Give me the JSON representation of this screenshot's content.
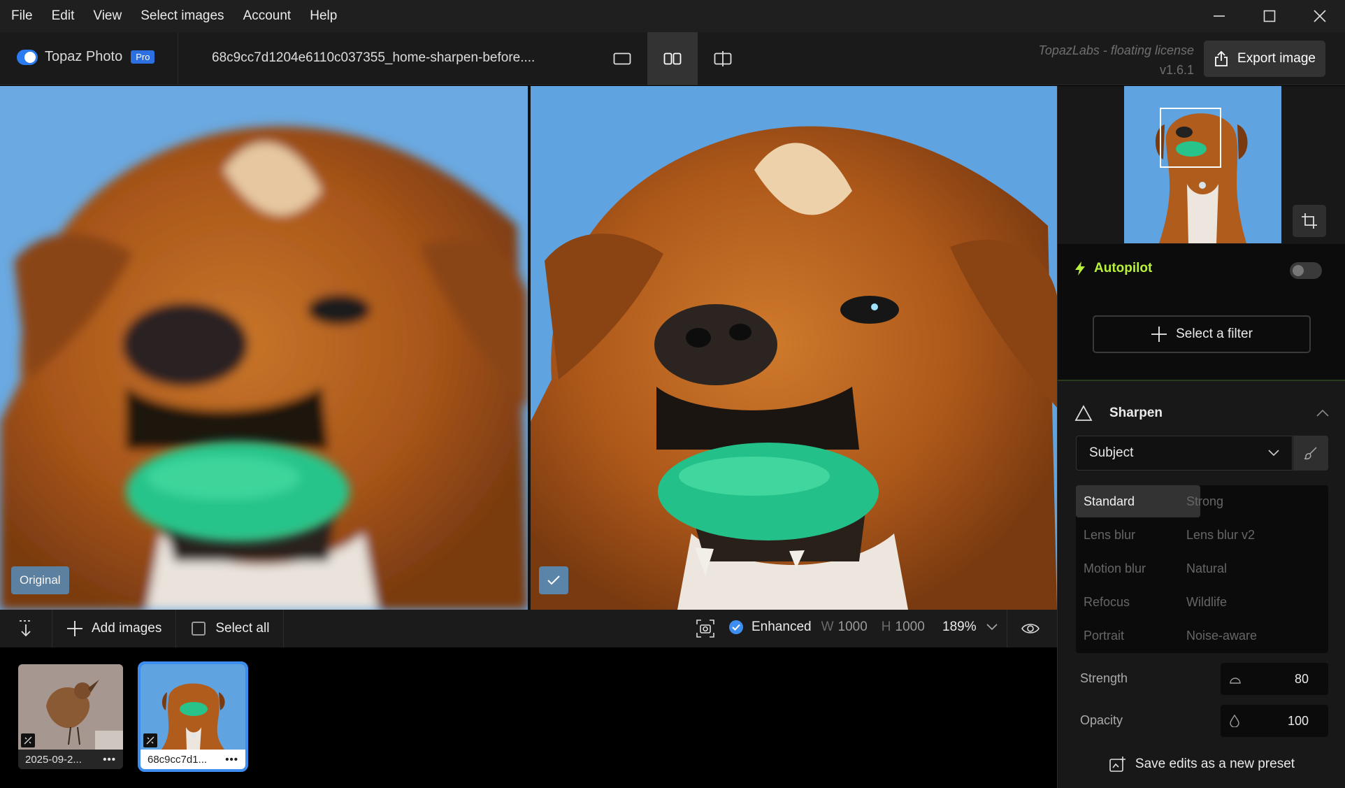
{
  "menu": [
    "File",
    "Edit",
    "View",
    "Select images",
    "Account",
    "Help"
  ],
  "window_controls": [
    "minimize-icon",
    "maximize-icon",
    "close-icon"
  ],
  "toolbar": {
    "app_name": "Topaz Photo",
    "pro_badge": "Pro",
    "filename": "68c9cc7d1204e6110c037355_home-sharpen-before....",
    "license_text": "TopazLabs - floating license",
    "version": "v1.6.1",
    "export_label": "Export image",
    "view_modes": [
      "single-view-icon",
      "side-by-side-view-icon",
      "split-view-icon"
    ],
    "active_view_mode": "side-by-side"
  },
  "viewer": {
    "left_badge": "Original",
    "right_badge_icon": "check-icon"
  },
  "viewer_bar": {
    "add_images": "Add images",
    "select_all": "Select all",
    "status": "Enhanced",
    "width_label": "W",
    "width_value": "1000",
    "height_label": "H",
    "height_value": "1000",
    "zoom": "189%"
  },
  "filmstrip": [
    {
      "label": "2025-09-2...",
      "selected": false
    },
    {
      "label": "68c9cc7d1...",
      "selected": true
    }
  ],
  "sidebar": {
    "autopilot_label": "Autopilot",
    "autopilot_on": false,
    "select_filter": "Select a filter",
    "filter_title": "Sharpen",
    "subject_value": "Subject",
    "models": [
      "Standard",
      "Strong",
      "Lens blur",
      "Lens blur v2",
      "Motion blur",
      "Natural",
      "Refocus",
      "Wildlife",
      "Portrait",
      "Noise-aware"
    ],
    "active_model": "Standard",
    "strength_label": "Strength",
    "strength_value": "80",
    "opacity_label": "Opacity",
    "opacity_value": "100",
    "save_preset": "Save edits as a new preset"
  },
  "colors": {
    "accent_blue": "#2b7cf0",
    "autopilot_green": "#b9f23a",
    "photo_sky": "#5fa3e0",
    "dog_fur": "#b5621f",
    "ball_green": "#28c38a"
  }
}
